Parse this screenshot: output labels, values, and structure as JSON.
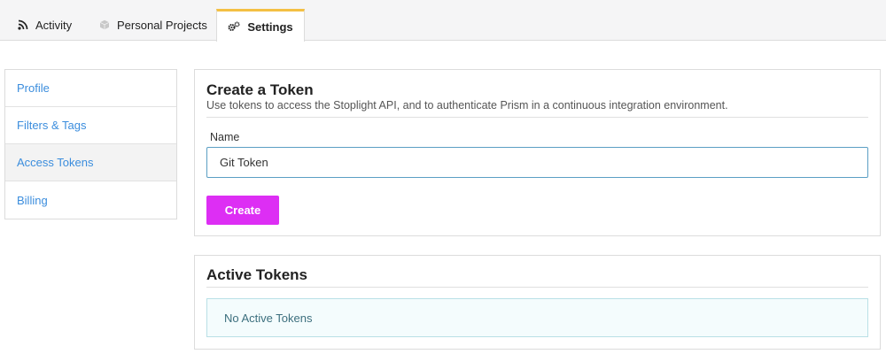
{
  "tabs": {
    "activity": {
      "label": "Activity",
      "icon": "rss-icon"
    },
    "projects": {
      "label": "Personal Projects",
      "icon": "cube-icon"
    },
    "settings": {
      "label": "Settings",
      "icon": "gears-icon",
      "active": true
    }
  },
  "sidebar": {
    "items": [
      {
        "label": "Profile",
        "active": false
      },
      {
        "label": "Filters & Tags",
        "active": false
      },
      {
        "label": "Access Tokens",
        "active": true
      },
      {
        "label": "Billing",
        "active": false
      }
    ]
  },
  "create_token": {
    "title": "Create a Token",
    "description": "Use tokens to access the Stoplight API, and to authenticate Prism in a continuous integration environment.",
    "name_label": "Name",
    "name_value": "Git Token",
    "create_button": "Create"
  },
  "active_tokens": {
    "title": "Active Tokens",
    "empty_message": "No Active Tokens"
  },
  "colors": {
    "accent_tab": "#f4c043",
    "create_button": "#dd2ef4",
    "link": "#3b8ddd",
    "info_box_bg": "#f4fcfd"
  }
}
